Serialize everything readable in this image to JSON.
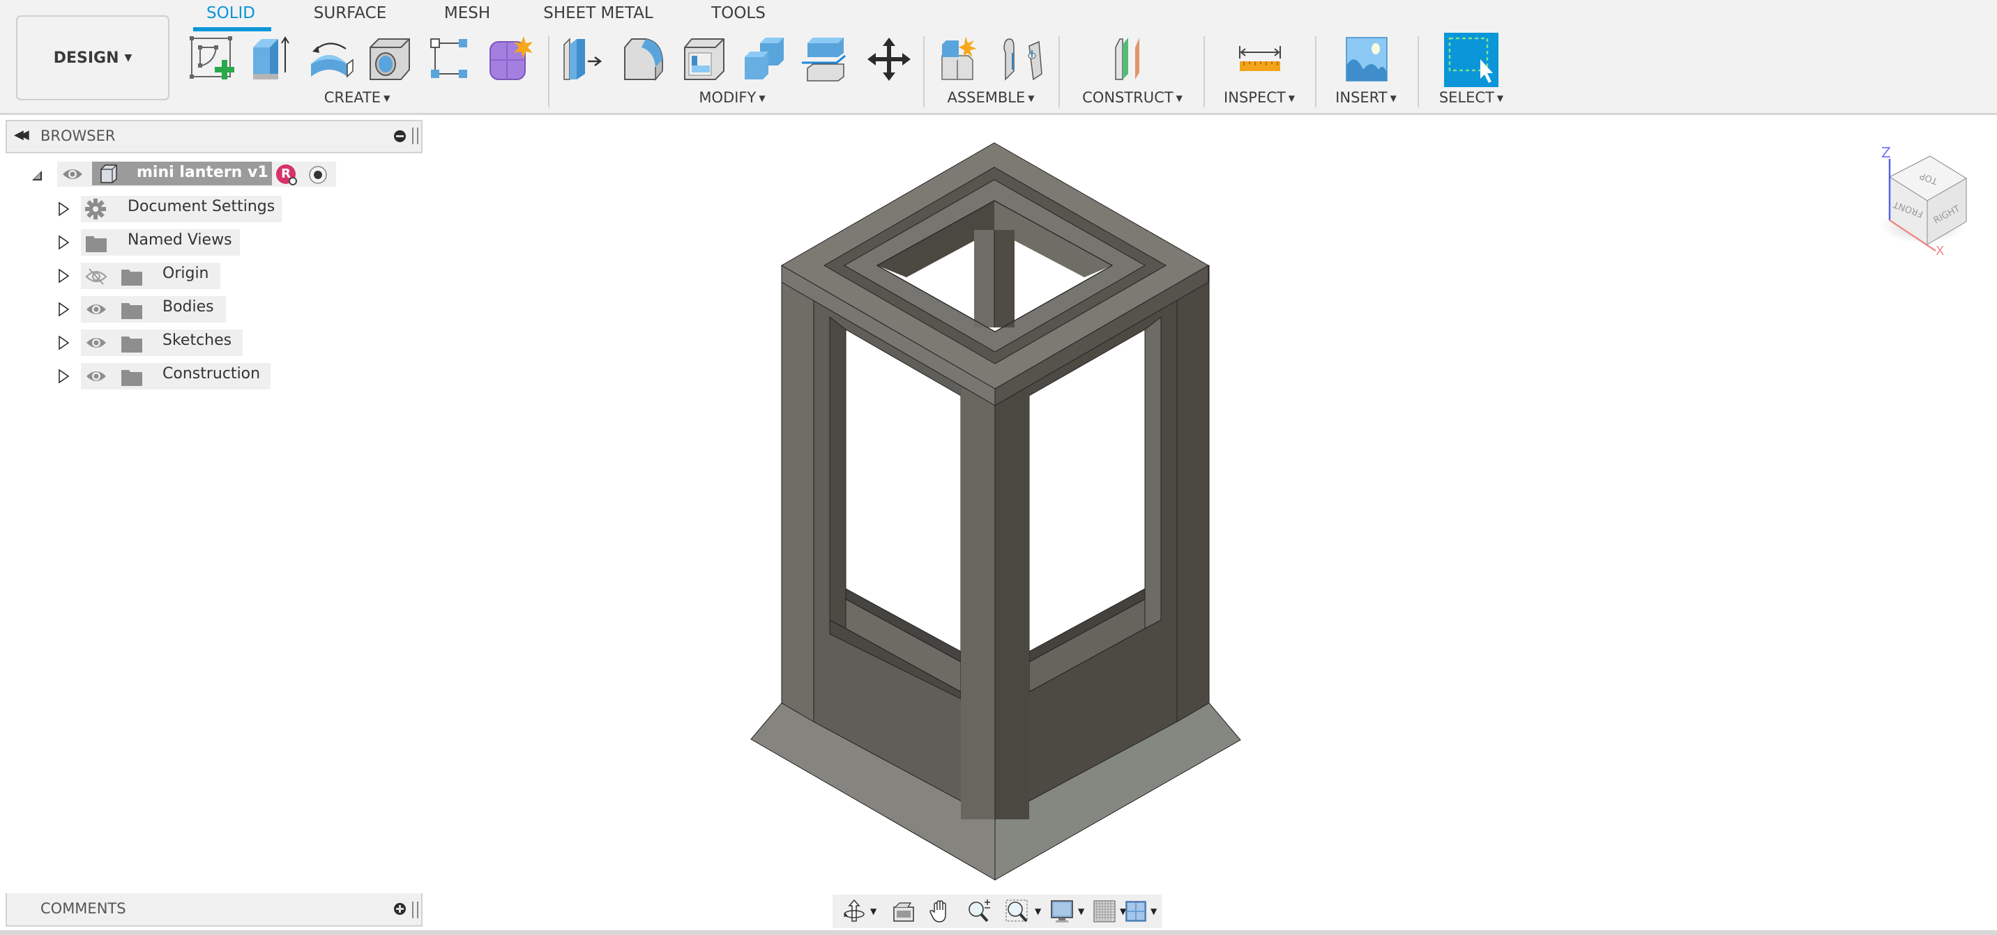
{
  "workspace": {
    "label": "DESIGN"
  },
  "tabs": [
    {
      "label": "SOLID",
      "active": true
    },
    {
      "label": "SURFACE",
      "active": false
    },
    {
      "label": "MESH",
      "active": false
    },
    {
      "label": "SHEET METAL",
      "active": false
    },
    {
      "label": "TOOLS",
      "active": false
    }
  ],
  "toolbar_groups": [
    {
      "label": "CREATE",
      "tools": [
        "create-sketch",
        "extrude",
        "revolve",
        "hole",
        "pattern",
        "create-form"
      ]
    },
    {
      "label": "MODIFY",
      "tools": [
        "press-pull",
        "fillet",
        "shell",
        "combine",
        "split-body",
        "move-copy"
      ]
    },
    {
      "label": "ASSEMBLE",
      "tools": [
        "new-component",
        "joint"
      ]
    },
    {
      "label": "CONSTRUCT",
      "tools": [
        "offset-plane"
      ]
    },
    {
      "label": "INSPECT",
      "tools": [
        "measure"
      ]
    },
    {
      "label": "INSERT",
      "tools": [
        "insert-image"
      ]
    },
    {
      "label": "SELECT",
      "tools": [
        "select"
      ]
    }
  ],
  "browser": {
    "title": "BROWSER",
    "root": {
      "label": "mini lantern v1",
      "user_badge": "R"
    },
    "items": [
      {
        "label": "Document Settings",
        "icon": "gear-icon",
        "visibility": null
      },
      {
        "label": "Named Views",
        "icon": "folder-icon",
        "visibility": null
      },
      {
        "label": "Origin",
        "icon": "folder-icon",
        "visibility": "hidden"
      },
      {
        "label": "Bodies",
        "icon": "folder-icon",
        "visibility": "visible"
      },
      {
        "label": "Sketches",
        "icon": "folder-icon",
        "visibility": "visible"
      },
      {
        "label": "Construction",
        "icon": "folder-icon",
        "visibility": "visible"
      }
    ]
  },
  "comments": {
    "title": "COMMENTS"
  },
  "viewcube": {
    "top": "TOP",
    "front": "FRONT",
    "right": "RIGHT",
    "axis_z": "Z",
    "axis_x": "X"
  },
  "navbar": [
    "orbit",
    "look-at",
    "pan",
    "zoom",
    "fit-window",
    "display-settings",
    "grid-snaps",
    "viewports"
  ],
  "colors": {
    "accent": "#0a96d8",
    "ribbon_bg": "#f2f2f2",
    "model_light": "#85847d",
    "model_mid": "#65645d",
    "model_dark": "#4a4740",
    "badge": "#d6336c"
  }
}
